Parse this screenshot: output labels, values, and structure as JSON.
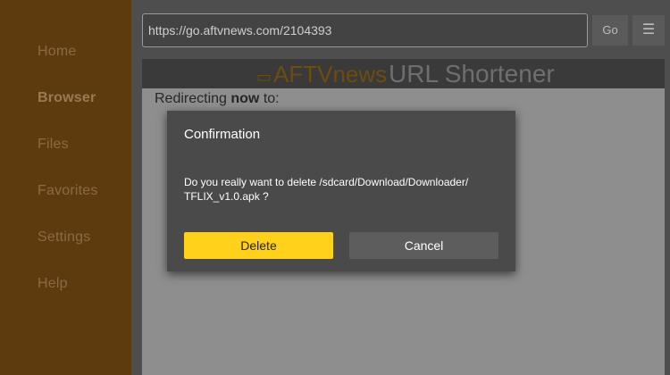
{
  "sidebar": {
    "items": [
      {
        "label": "Home"
      },
      {
        "label": "Browser"
      },
      {
        "label": "Files"
      },
      {
        "label": "Favorites"
      },
      {
        "label": "Settings"
      },
      {
        "label": "Help"
      }
    ],
    "active": "Browser"
  },
  "browser": {
    "url": "https://go.aftvnews.com/2104393",
    "go_label": "Go",
    "menu_icon": "menu-icon"
  },
  "webpage": {
    "logo_text": "AFTVnews",
    "title": "URL Shortener",
    "redirect_prefix": "Redirecting ",
    "redirect_bold": "now",
    "redirect_suffix": " to:"
  },
  "dialog": {
    "title": "Confirmation",
    "message": "Do you really want to delete /sdcard/Download/Downloader/ TFLIX_v1.0.apk ?",
    "delete_label": "Delete",
    "cancel_label": "Cancel"
  },
  "colors": {
    "accent": "#ffd11a",
    "sidebar": "#5e3b0f"
  }
}
